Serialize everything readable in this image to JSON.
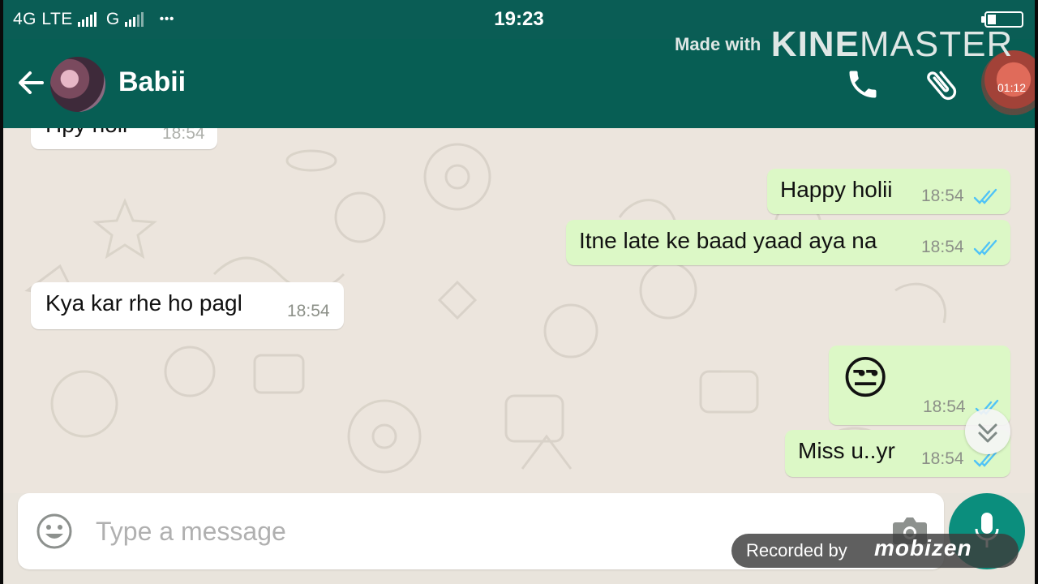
{
  "status_bar": {
    "network": "4G LTE",
    "network2": "G",
    "dots": "•••",
    "time": "19:23"
  },
  "watermark": {
    "made_with": "Made with",
    "brand_bold": "KINE",
    "brand_rest": "MASTER",
    "timer": "01:12"
  },
  "header": {
    "contact_name": "Babii"
  },
  "messages": [
    {
      "direction": "incoming",
      "text": "Hpy holi",
      "time": "18:54"
    },
    {
      "direction": "outgoing",
      "text": "Happy holii",
      "time": "18:54",
      "status": "read"
    },
    {
      "direction": "outgoing",
      "text": "Itne late ke baad yaad aya na",
      "time": "18:54",
      "status": "read"
    },
    {
      "direction": "incoming",
      "text": "Kya kar rhe ho pagl",
      "time": "18:54"
    },
    {
      "direction": "outgoing",
      "text": "😒",
      "time": "18:54",
      "status": "read"
    },
    {
      "direction": "outgoing",
      "text": "Miss u..yr",
      "time": "18:54",
      "status": "read"
    }
  ],
  "input": {
    "placeholder": "Type a message"
  },
  "recorder_badge": {
    "text": "Recorded by",
    "brand": "mobizen"
  },
  "colors": {
    "header": "#075e54",
    "status_bar": "#0a5d55",
    "outgoing_bubble": "#dcf8c6",
    "incoming_bubble": "#ffffff",
    "read_ticks": "#4fc3f7",
    "mic_button": "#0b8e7d"
  }
}
